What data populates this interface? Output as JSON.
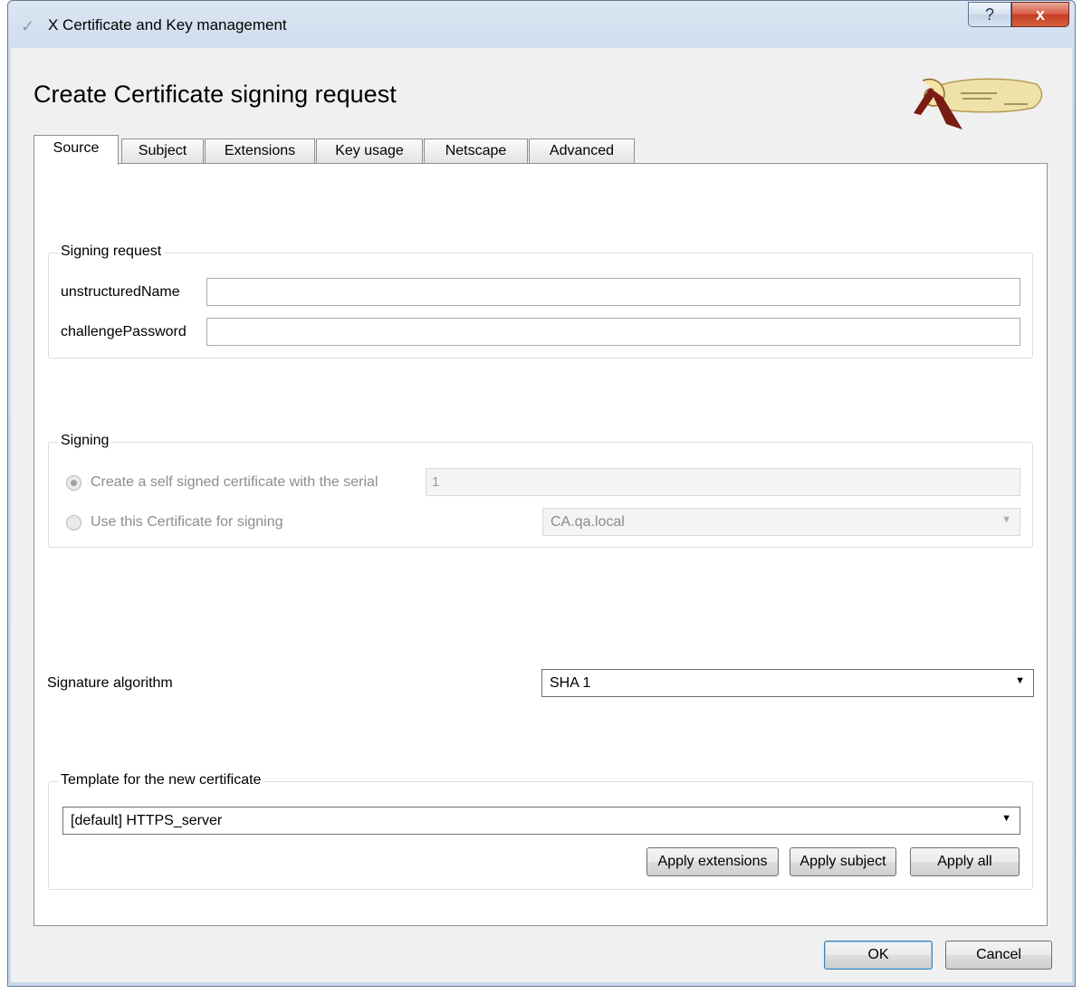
{
  "window": {
    "title": "X Certificate and Key management",
    "help_label": "?",
    "close_label": "x"
  },
  "dialog": {
    "title": "Create Certificate signing request",
    "logo_icon": "xca-scroll-logo"
  },
  "tabs": [
    {
      "label": "Source",
      "active": true
    },
    {
      "label": "Subject",
      "active": false
    },
    {
      "label": "Extensions",
      "active": false
    },
    {
      "label": "Key usage",
      "active": false
    },
    {
      "label": "Netscape",
      "active": false
    },
    {
      "label": "Advanced",
      "active": false
    }
  ],
  "signing_request": {
    "group_label": "Signing request",
    "unstructured_name_label": "unstructuredName",
    "unstructured_name_value": "",
    "challenge_password_label": "challengePassword",
    "challenge_password_value": ""
  },
  "signing": {
    "group_label": "Signing",
    "self_signed_label": "Create a self signed certificate with the serial",
    "self_signed_selected": true,
    "serial_value": "1",
    "use_cert_label": "Use this Certificate for signing",
    "use_cert_selected": false,
    "ca_value": "CA.qa.local"
  },
  "signature": {
    "label": "Signature algorithm",
    "value": "SHA 1"
  },
  "template": {
    "group_label": "Template for the new certificate",
    "value": "[default] HTTPS_server",
    "apply_extensions_label": "Apply extensions",
    "apply_subject_label": "Apply subject",
    "apply_all_label": "Apply all"
  },
  "footer": {
    "ok_label": "OK",
    "cancel_label": "Cancel"
  },
  "colors": {
    "titlebar": "#cfdcec",
    "close_button": "#c33d22",
    "panel": "#ffffff",
    "dialog_bg": "#f0f0f0"
  }
}
